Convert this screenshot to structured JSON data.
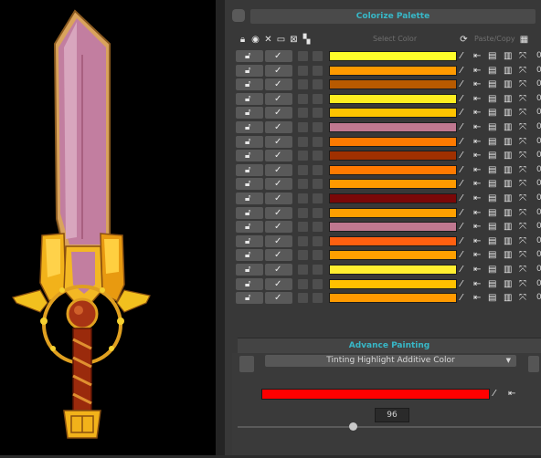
{
  "palette_panel": {
    "title": "Colorize Palette",
    "header": {
      "select_color_label": "Select Color",
      "paste_copy_label": "Paste/Copy"
    },
    "rows": [
      {
        "color": "#ffff2a",
        "value": "0"
      },
      {
        "color": "#ff9a00",
        "value": "0"
      },
      {
        "color": "#b85a00",
        "value": "0"
      },
      {
        "color": "#ffee20",
        "value": "0"
      },
      {
        "color": "#ffc400",
        "value": "0"
      },
      {
        "color": "#c07890",
        "value": "0"
      },
      {
        "color": "#ff7a00",
        "value": "0"
      },
      {
        "color": "#a03000",
        "value": "0"
      },
      {
        "color": "#ff7a00",
        "value": "0"
      },
      {
        "color": "#ff9a00",
        "value": "0"
      },
      {
        "color": "#7a0808",
        "value": "0"
      },
      {
        "color": "#ffa000",
        "value": "0"
      },
      {
        "color": "#c07890",
        "value": "0"
      },
      {
        "color": "#ff6010",
        "value": "0"
      },
      {
        "color": "#ffa000",
        "value": "0"
      },
      {
        "color": "#ffee30",
        "value": "0"
      },
      {
        "color": "#ffc000",
        "value": "0"
      },
      {
        "color": "#ff9a00",
        "value": "0"
      }
    ]
  },
  "advance_painting": {
    "title": "Advance Painting",
    "mode": "Tinting Highlight Additive Color",
    "color": "#ff0000",
    "value": "96",
    "slider_fraction": 0.38
  },
  "icons": {
    "lock": "lock-icon",
    "brush": "brush-icon",
    "eyedropper": "eyedropper-icon",
    "copy": "copy-icon",
    "paste": "paste-icon",
    "shuffle": "shuffle-icon"
  }
}
